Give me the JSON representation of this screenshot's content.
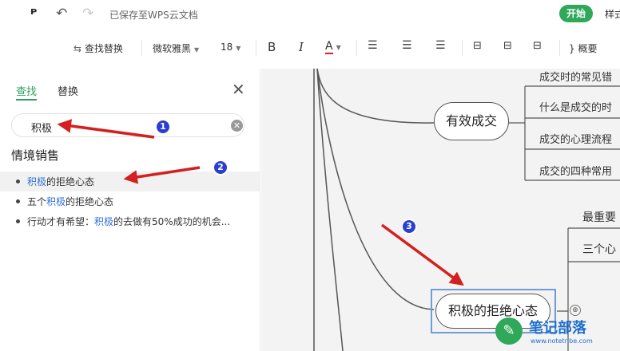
{
  "topbar": {
    "logo_glyph": "ᴾ",
    "undo_glyph": "↶",
    "redo_glyph": "↷",
    "save_status": "已保存至WPS云文档",
    "start_label": "开始",
    "style_label": "样式"
  },
  "toolbar": {
    "find_replace": "查找替换",
    "font_family": "微软雅黑",
    "font_size": "18",
    "bold": "B",
    "italic": "I",
    "font_color": "A",
    "summary": "概要"
  },
  "panel": {
    "tab_find": "查找",
    "tab_replace": "替换",
    "close_glyph": "✕",
    "search_value": "积极",
    "clear_glyph": "✕",
    "group_title": "情境销售",
    "results": [
      {
        "pre": "",
        "kw": "积极",
        "post": "的拒绝心态"
      },
      {
        "pre": "五个",
        "kw": "积极",
        "post": "的拒绝心态"
      },
      {
        "pre": "行动才有希望：",
        "kw": "积极",
        "post": "的去做有50%成功的机会..."
      }
    ]
  },
  "canvas": {
    "node_effective": "有效成交",
    "leaves": [
      "成交时的常见错",
      "什么是成交的时",
      "成交的心理流程",
      "成交的四种常用"
    ],
    "node_positive": "积极的拒绝心态",
    "branch_most": "最重要",
    "branch_three": "三个心"
  },
  "annotations": {
    "badge1": "1",
    "badge2": "2",
    "badge3": "3"
  },
  "watermark": {
    "title": "笔记部落",
    "url": "www.notetribe.com"
  },
  "colors": {
    "accent_green": "#2fa85a",
    "keyword_blue": "#2f6fd8",
    "arrow_red": "#d42020",
    "badge_blue": "#2a3fd1"
  }
}
